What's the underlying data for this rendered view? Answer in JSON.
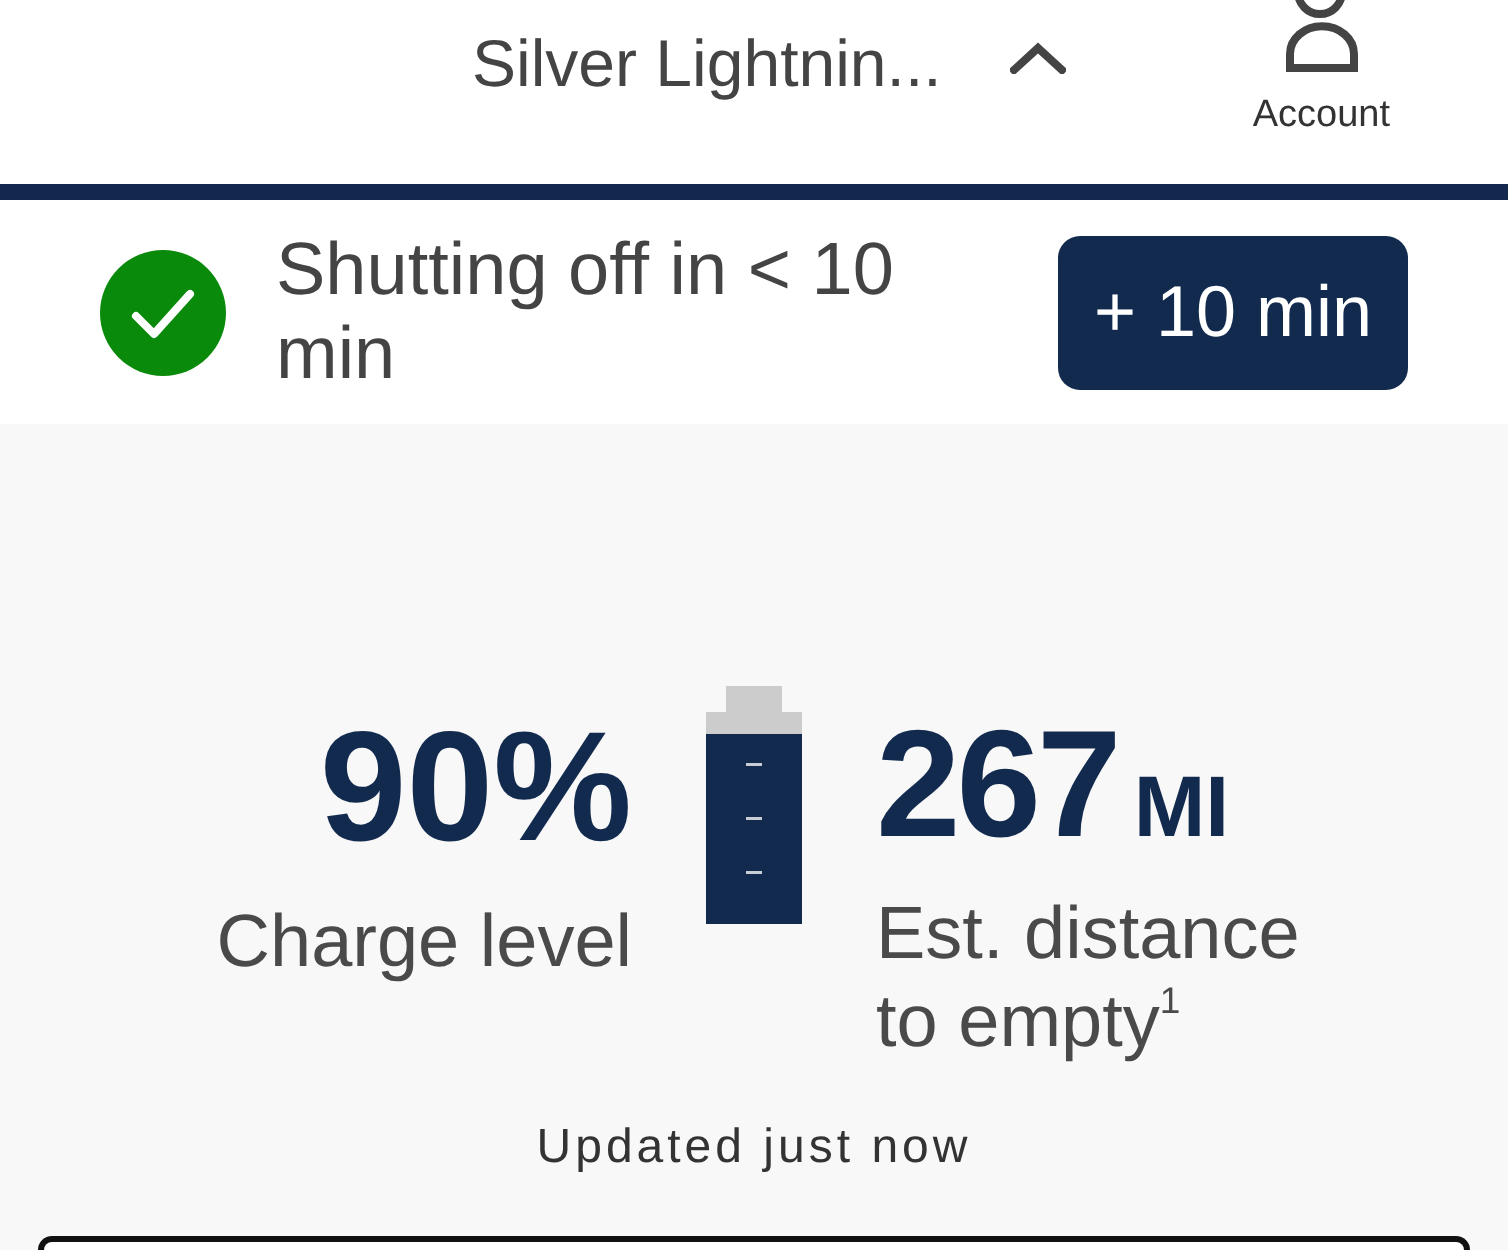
{
  "header": {
    "vehicle_name": "Silver Lightnin...",
    "account_label": "Account"
  },
  "status_banner": {
    "message": "Shutting off in < 10 min",
    "button": "+ 10 min"
  },
  "stats": {
    "charge": {
      "value": "90%",
      "label": "Charge level"
    },
    "range": {
      "value": "267",
      "unit": "MI",
      "label": "Est. distance to empty$^{1}$"
    }
  },
  "updated": "Updated just now"
}
